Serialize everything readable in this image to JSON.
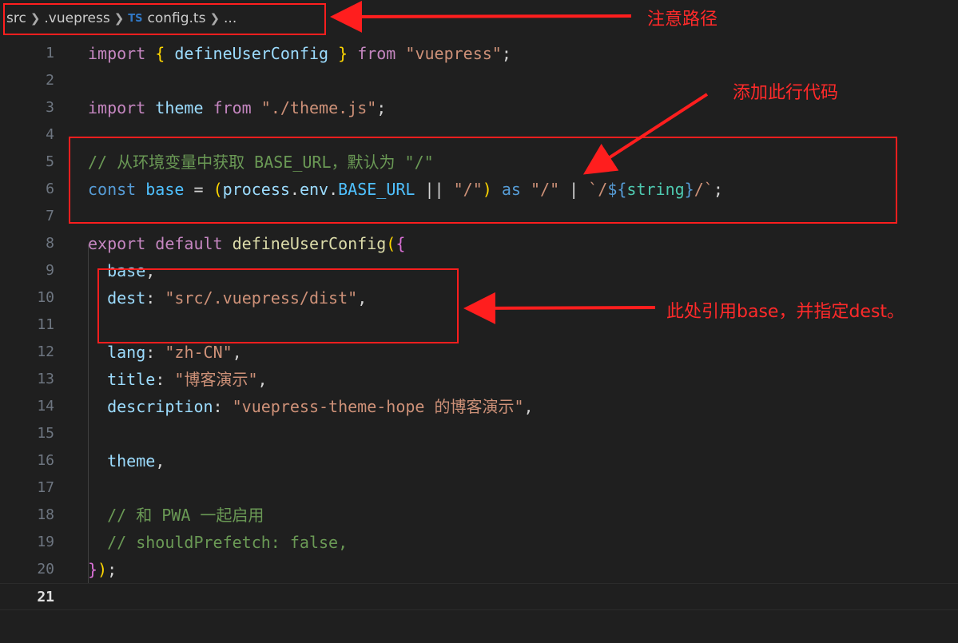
{
  "breadcrumb": {
    "items": [
      "src",
      ".vuepress",
      "config.ts",
      "..."
    ],
    "file_icon": "TS"
  },
  "editor": {
    "lines": [
      {
        "n": "1",
        "tokens": [
          [
            "kw",
            "import"
          ],
          [
            "pl",
            " "
          ],
          [
            "b1",
            "{"
          ],
          [
            "pl",
            " "
          ],
          [
            "var",
            "defineUserConfig"
          ],
          [
            "pl",
            " "
          ],
          [
            "b1",
            "}"
          ],
          [
            "pl",
            " "
          ],
          [
            "kw",
            "from"
          ],
          [
            "pl",
            " "
          ],
          [
            "str",
            "\"vuepress\""
          ],
          [
            "pl",
            ";"
          ]
        ]
      },
      {
        "n": "2",
        "tokens": []
      },
      {
        "n": "3",
        "tokens": [
          [
            "kw",
            "import"
          ],
          [
            "pl",
            " "
          ],
          [
            "var",
            "theme"
          ],
          [
            "pl",
            " "
          ],
          [
            "kw",
            "from"
          ],
          [
            "pl",
            " "
          ],
          [
            "str",
            "\"./theme.js\""
          ],
          [
            "pl",
            ";"
          ]
        ]
      },
      {
        "n": "4",
        "tokens": []
      },
      {
        "n": "5",
        "tokens": [
          [
            "cmt",
            "// 从环境变量中获取 BASE_URL，默认为 \"/\""
          ]
        ]
      },
      {
        "n": "6",
        "tokens": [
          [
            "kw2",
            "const"
          ],
          [
            "pl",
            " "
          ],
          [
            "const",
            "base"
          ],
          [
            "pl",
            " = "
          ],
          [
            "b1",
            "("
          ],
          [
            "var",
            "process"
          ],
          [
            "pl",
            "."
          ],
          [
            "var",
            "env"
          ],
          [
            "pl",
            "."
          ],
          [
            "const",
            "BASE_URL"
          ],
          [
            "pl",
            " || "
          ],
          [
            "str",
            "\"/\""
          ],
          [
            "b1",
            ")"
          ],
          [
            "pl",
            " "
          ],
          [
            "kw2",
            "as"
          ],
          [
            "pl",
            " "
          ],
          [
            "str",
            "\"/\""
          ],
          [
            "pl",
            " | "
          ],
          [
            "str",
            "`/"
          ],
          [
            "kw2",
            "${"
          ],
          [
            "typ",
            "string"
          ],
          [
            "kw2",
            "}"
          ],
          [
            "str",
            "/`"
          ],
          [
            "pl",
            ";"
          ]
        ]
      },
      {
        "n": "7",
        "tokens": []
      },
      {
        "n": "8",
        "tokens": [
          [
            "kw",
            "export"
          ],
          [
            "pl",
            " "
          ],
          [
            "kw",
            "default"
          ],
          [
            "pl",
            " "
          ],
          [
            "fn",
            "defineUserConfig"
          ],
          [
            "b1",
            "("
          ],
          [
            "b2",
            "{"
          ]
        ]
      },
      {
        "n": "9",
        "tokens": [
          [
            "pl",
            "  "
          ],
          [
            "var",
            "base"
          ],
          [
            "pl",
            ","
          ]
        ]
      },
      {
        "n": "10",
        "tokens": [
          [
            "pl",
            "  "
          ],
          [
            "var",
            "dest"
          ],
          [
            "pl",
            ": "
          ],
          [
            "str",
            "\"src/.vuepress/dist\""
          ],
          [
            "pl",
            ","
          ]
        ]
      },
      {
        "n": "11",
        "tokens": []
      },
      {
        "n": "12",
        "tokens": [
          [
            "pl",
            "  "
          ],
          [
            "var",
            "lang"
          ],
          [
            "pl",
            ": "
          ],
          [
            "str",
            "\"zh-CN\""
          ],
          [
            "pl",
            ","
          ]
        ]
      },
      {
        "n": "13",
        "tokens": [
          [
            "pl",
            "  "
          ],
          [
            "var",
            "title"
          ],
          [
            "pl",
            ": "
          ],
          [
            "str",
            "\"博客演示\""
          ],
          [
            "pl",
            ","
          ]
        ]
      },
      {
        "n": "14",
        "tokens": [
          [
            "pl",
            "  "
          ],
          [
            "var",
            "description"
          ],
          [
            "pl",
            ": "
          ],
          [
            "str",
            "\"vuepress-theme-hope 的博客演示\""
          ],
          [
            "pl",
            ","
          ]
        ]
      },
      {
        "n": "15",
        "tokens": []
      },
      {
        "n": "16",
        "tokens": [
          [
            "pl",
            "  "
          ],
          [
            "var",
            "theme"
          ],
          [
            "pl",
            ","
          ]
        ]
      },
      {
        "n": "17",
        "tokens": []
      },
      {
        "n": "18",
        "tokens": [
          [
            "pl",
            "  "
          ],
          [
            "cmt",
            "// 和 PWA 一起启用"
          ]
        ]
      },
      {
        "n": "19",
        "tokens": [
          [
            "pl",
            "  "
          ],
          [
            "cmt",
            "// shouldPrefetch: false,"
          ]
        ]
      },
      {
        "n": "20",
        "tokens": [
          [
            "b2",
            "}"
          ],
          [
            "b1",
            ")"
          ],
          [
            "pl",
            ";"
          ]
        ]
      },
      {
        "n": "21",
        "tokens": []
      }
    ],
    "active_line": "21"
  },
  "annotations": {
    "path_note": "注意路径",
    "add_line_note": "添加此行代码",
    "base_note": "此处引用base，并指定dest。"
  },
  "colors": {
    "annotation": "#ff1e1e",
    "background": "#1f1f1f"
  }
}
